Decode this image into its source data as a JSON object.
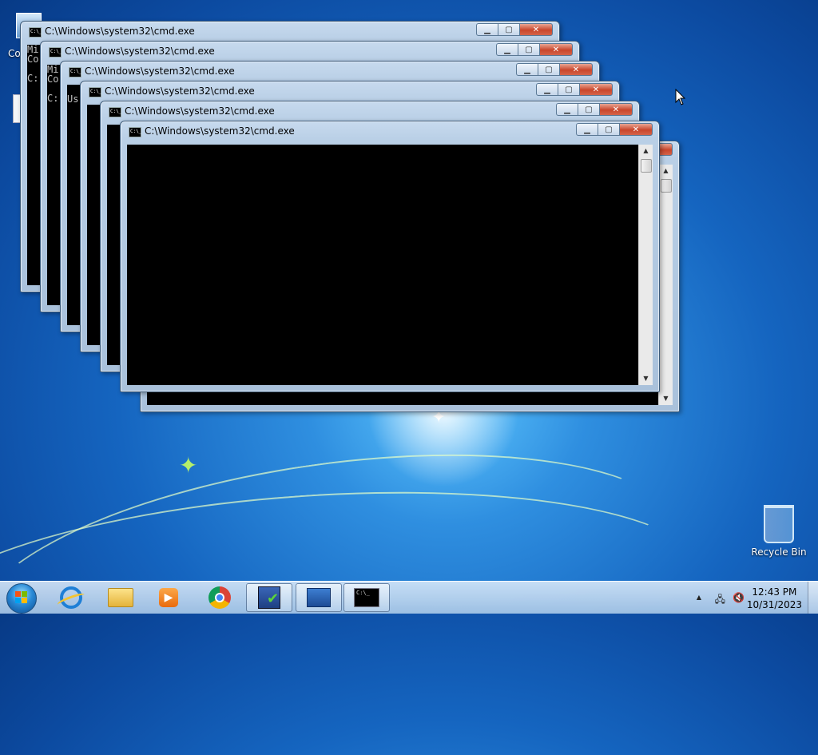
{
  "desktop": {
    "icons": [
      {
        "label": "Co",
        "glyph": "computer-icon"
      },
      {
        "label": "Recycle Bin",
        "glyph": "recycle-bin-icon"
      }
    ]
  },
  "cmd_windows": [
    {
      "title": "C:\\Windows\\system32\\cmd.exe",
      "lines": [
        "Mi",
        "Co",
        "",
        "C:"
      ]
    },
    {
      "title": "C:\\Windows\\system32\\cmd.exe",
      "lines": [
        "Mi",
        "Co",
        "",
        "C:"
      ]
    },
    {
      "title": "C:\\Windows\\system32\\cmd.exe",
      "lines": [
        "",
        "Us"
      ]
    },
    {
      "title": "C:\\Windows\\system32\\cmd.exe",
      "lines": []
    },
    {
      "title": "C:\\Windows\\system32\\cmd.exe",
      "lines": []
    },
    {
      "title": "C:\\Windows\\system32\\cmd.exe",
      "lines": []
    },
    {
      "title": "",
      "lines": []
    }
  ],
  "window_buttons": {
    "minimize": "▁",
    "maximize": "▢",
    "close": "✕"
  },
  "taskbar": {
    "items": [
      {
        "name": "internet-explorer-icon"
      },
      {
        "name": "file-explorer-icon"
      },
      {
        "name": "media-player-icon"
      },
      {
        "name": "chrome-icon"
      },
      {
        "name": "task-checklist-icon"
      },
      {
        "name": "on-screen-keyboard-icon"
      },
      {
        "name": "command-prompt-icon"
      }
    ],
    "tray": {
      "show_hidden": "▲",
      "network": "🖧",
      "volume": "🔇",
      "time": "12:43 PM",
      "date": "10/31/2023"
    }
  },
  "cmd_icon_text": "C:\\_"
}
